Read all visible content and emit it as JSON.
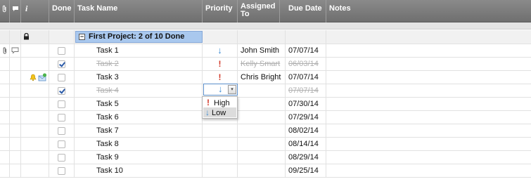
{
  "columns": {
    "attachment": "",
    "comment": "",
    "info": "i",
    "done": "Done",
    "task_name": "Task Name",
    "priority": "Priority",
    "assigned_to": "Assigned To",
    "due_date": "Due Date",
    "notes": "Notes"
  },
  "parent": {
    "toggle": "−",
    "label": "First Project: 2 of 10 Done"
  },
  "priority_icons": {
    "low": "↓",
    "high": "!"
  },
  "rows": [
    {
      "task": "Task 1",
      "done": false,
      "priority": "low",
      "assigned": "John Smith",
      "due": "07/07/14"
    },
    {
      "task": "Task 2",
      "done": true,
      "priority": "high",
      "assigned": "Kelly Smart",
      "due": "06/03/14"
    },
    {
      "task": "Task 3",
      "done": false,
      "priority": "high",
      "assigned": "Chris Bright",
      "due": "07/07/14"
    },
    {
      "task": "Task 4",
      "done": true,
      "priority": "low",
      "assigned": "",
      "due": "07/07/14"
    },
    {
      "task": "Task 5",
      "done": false,
      "priority": "",
      "assigned": "",
      "due": "07/30/14"
    },
    {
      "task": "Task 6",
      "done": false,
      "priority": "",
      "assigned": "",
      "due": "07/29/14"
    },
    {
      "task": "Task 7",
      "done": false,
      "priority": "",
      "assigned": "",
      "due": "08/02/14"
    },
    {
      "task": "Task 8",
      "done": false,
      "priority": "",
      "assigned": "",
      "due": "08/14/14"
    },
    {
      "task": "Task 9",
      "done": false,
      "priority": "",
      "assigned": "",
      "due": "08/29/14"
    },
    {
      "task": "Task 10",
      "done": false,
      "priority": "",
      "assigned": "",
      "due": "09/25/14"
    }
  ],
  "priority_dropdown": {
    "current": "↓",
    "toggle": "▾",
    "options": [
      {
        "icon": "!",
        "label": "High"
      },
      {
        "icon": "↓",
        "label": "Low"
      }
    ],
    "highlighted": "Low"
  },
  "colors": {
    "header": "#7d7d7d",
    "parent_highlight": "#a9c8ee",
    "low_arrow": "#3a8ad2",
    "high_bang": "#d23a2a"
  }
}
